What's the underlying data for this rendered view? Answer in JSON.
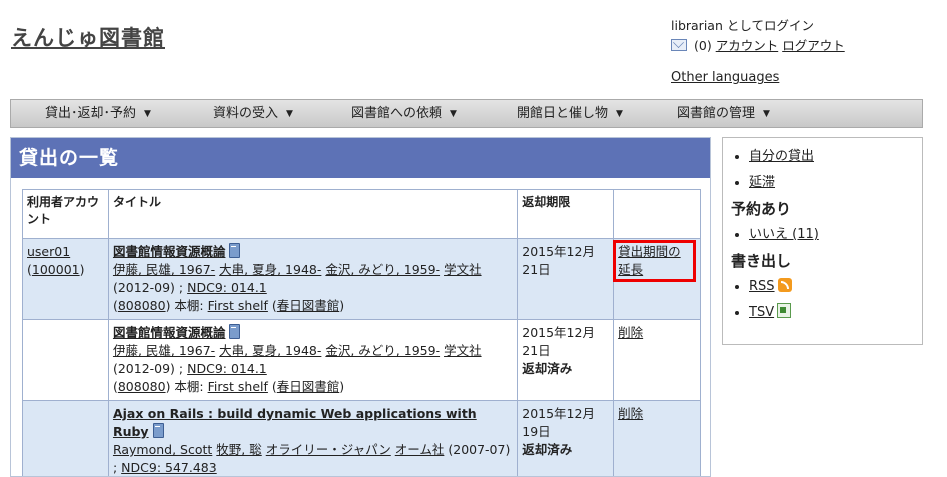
{
  "header": {
    "site_title": "えんじゅ図書館",
    "login_status": "librarian としてログイン",
    "message_count": "(0)",
    "account_link": "アカウント",
    "logout_link": "ログアウト",
    "other_languages": "Other languages"
  },
  "nav": {
    "items": [
      {
        "label": "貸出･返却･予約"
      },
      {
        "label": "資料の受入"
      },
      {
        "label": "図書館への依頼"
      },
      {
        "label": "開館日と催し物"
      },
      {
        "label": "図書館の管理"
      }
    ],
    "caret": "▼"
  },
  "main": {
    "heading": "貸出の一覧",
    "columns": [
      "利用者アカウント",
      "タイトル",
      "返却期限",
      ""
    ],
    "rows": [
      {
        "user_name": "user01",
        "user_number": "100001",
        "title": "図書館情報資源概論",
        "creators": [
          "伊藤, 民雄, 1967-",
          "大串, 夏身, 1948-",
          "金沢, みどり, 1959-"
        ],
        "publisher": "学文社",
        "pub_date": "(2012-09)",
        "sep": ";",
        "ndc": "NDC9: 014.1",
        "item_id": "808080",
        "shelf_label": "本棚:",
        "shelf": "First shelf",
        "library": "春日図書館",
        "due_date": "2015年12月21日",
        "status": "",
        "action": "貸出期間の延長"
      },
      {
        "user_name": "",
        "user_number": "",
        "title": "図書館情報資源概論",
        "creators": [
          "伊藤, 民雄, 1967-",
          "大串, 夏身, 1948-",
          "金沢, みどり, 1959-"
        ],
        "publisher": "学文社",
        "pub_date": "(2012-09)",
        "sep": ";",
        "ndc": "NDC9: 014.1",
        "item_id": "808080",
        "shelf_label": "本棚:",
        "shelf": "First shelf",
        "library": "春日図書館",
        "due_date": "2015年12月21日",
        "status": "返却済み",
        "action": "削除"
      },
      {
        "user_name": "",
        "user_number": "",
        "title": "Ajax on Rails : build dynamic Web applications with Ruby",
        "creators": [
          "Raymond, Scott",
          "牧野, 聡",
          "オライリー・ジャパン"
        ],
        "publisher": "オーム社",
        "pub_date": "(2007-07)",
        "sep": ";",
        "ndc": "NDC9: 547.483",
        "due_date": "2015年12月19日",
        "status": "返却済み",
        "action": "削除"
      }
    ]
  },
  "sidebar": {
    "links": [
      "自分の貸出",
      "延滞"
    ],
    "reserved_heading": "予約あり",
    "reserved_links": [
      "いいえ (11)"
    ],
    "export_heading": "書き出し",
    "export_links": [
      "RSS",
      "TSV"
    ]
  }
}
